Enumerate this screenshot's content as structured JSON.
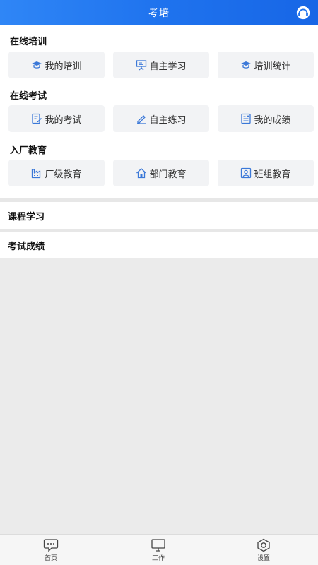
{
  "header": {
    "title": "考培"
  },
  "sections": {
    "training": {
      "title": "在线培训",
      "buttons": [
        {
          "label": "我的培训",
          "icon": "graduation-cap-icon"
        },
        {
          "label": "自主学习",
          "icon": "presentation-board-icon"
        },
        {
          "label": "培训统计",
          "icon": "graduation-cap-icon"
        }
      ]
    },
    "exam": {
      "title": "在线考试",
      "buttons": [
        {
          "label": "我的考试",
          "icon": "edit-document-icon"
        },
        {
          "label": "自主练习",
          "icon": "pencil-icon"
        },
        {
          "label": "我的成绩",
          "icon": "report-card-icon"
        }
      ]
    },
    "induction": {
      "title": "入厂教育",
      "buttons": [
        {
          "label": "厂级教育",
          "icon": "factory-icon"
        },
        {
          "label": "部门教育",
          "icon": "building-icon"
        },
        {
          "label": "班组教育",
          "icon": "team-badge-icon"
        }
      ]
    }
  },
  "list": {
    "course": "课程学习",
    "scores": "考试成绩"
  },
  "tabbar": {
    "home": "首页",
    "work": "工作",
    "settings": "设置"
  },
  "colors": {
    "header_blue": "#1f73ee",
    "icon_blue": "#3b78d8"
  }
}
